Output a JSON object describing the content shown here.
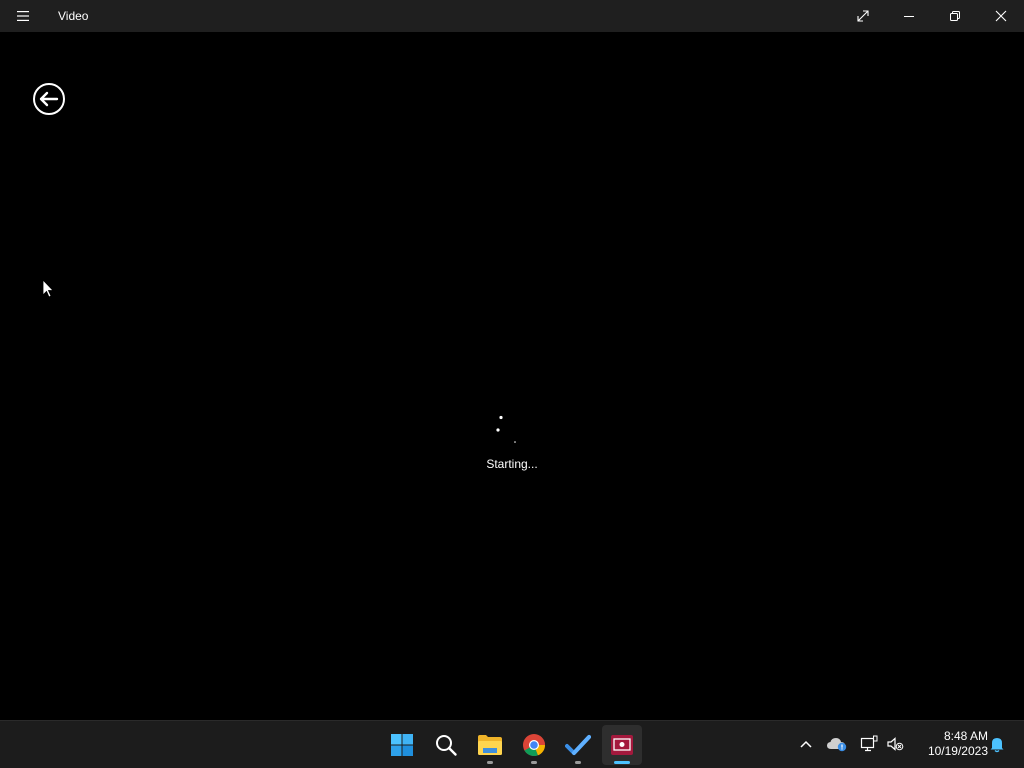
{
  "window": {
    "title": "Video",
    "menu_icon": "hamburger-menu-icon",
    "controls": [
      "fullscreen-icon",
      "minimize-icon",
      "restore-icon",
      "close-icon"
    ]
  },
  "content": {
    "back_icon": "back-arrow-circle-icon",
    "status_text": "Starting...",
    "spinner_icon": "loading-spinner-icon"
  },
  "taskbar": {
    "apps": [
      {
        "name": "start",
        "icon": "windows-start-icon",
        "active": false
      },
      {
        "name": "search",
        "icon": "search-icon",
        "active": false
      },
      {
        "name": "file-explorer",
        "icon": "folder-icon",
        "active": false
      },
      {
        "name": "chrome",
        "icon": "chrome-icon",
        "active": false
      },
      {
        "name": "todo",
        "icon": "checkmark-icon",
        "active": false
      },
      {
        "name": "remote-app",
        "icon": "remote-desktop-icon",
        "active": true
      }
    ],
    "tray": {
      "icons": [
        "chevron-up-icon",
        "onedrive-icon",
        "network-icon",
        "volume-muted-icon"
      ],
      "time": "8:48 AM",
      "date": "10/19/2023",
      "notification_icon": "bell-icon"
    }
  },
  "colors": {
    "titlebar_bg": "#1f1f1f",
    "content_bg": "#000000",
    "taskbar_bg": "#1c1c1c",
    "accent": "#4cc2ff",
    "app_icon_bg": "#a4193d"
  }
}
